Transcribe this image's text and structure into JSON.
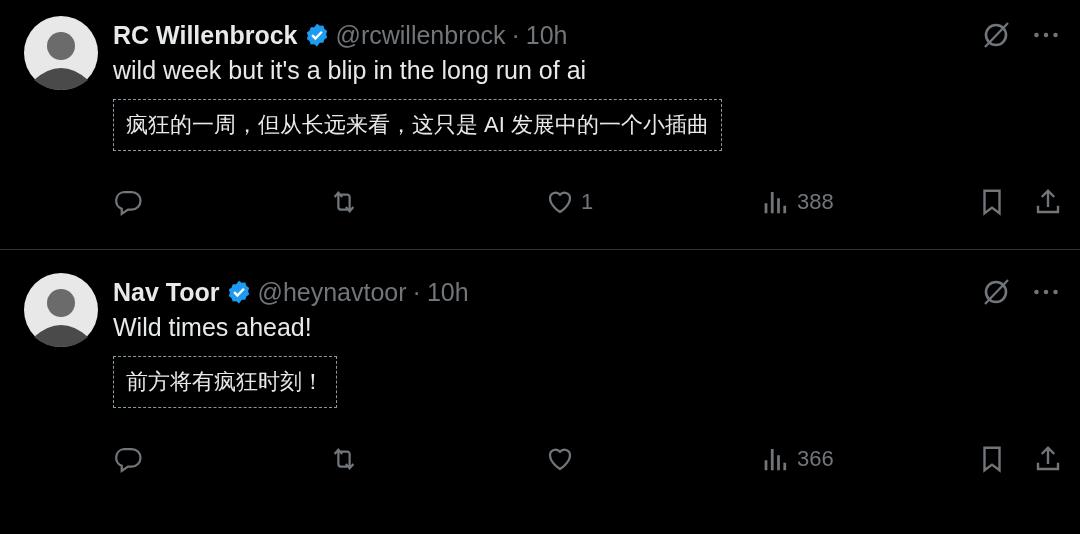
{
  "tweets": [
    {
      "name": "RC Willenbrock",
      "verified": true,
      "handle": "@rcwillenbrock",
      "separator": "·",
      "time": "10h",
      "text": "wild week but it's a blip in the long run of ai",
      "translation": "疯狂的一周，但从长远来看，这只是 AI 发展中的一个小插曲",
      "likes": "1",
      "views": "388"
    },
    {
      "name": "Nav Toor",
      "verified": true,
      "handle": "@heynavtoor",
      "separator": "·",
      "time": "10h",
      "text": "Wild times ahead!",
      "translation": "前方将有疯狂时刻！",
      "views": "366"
    }
  ]
}
